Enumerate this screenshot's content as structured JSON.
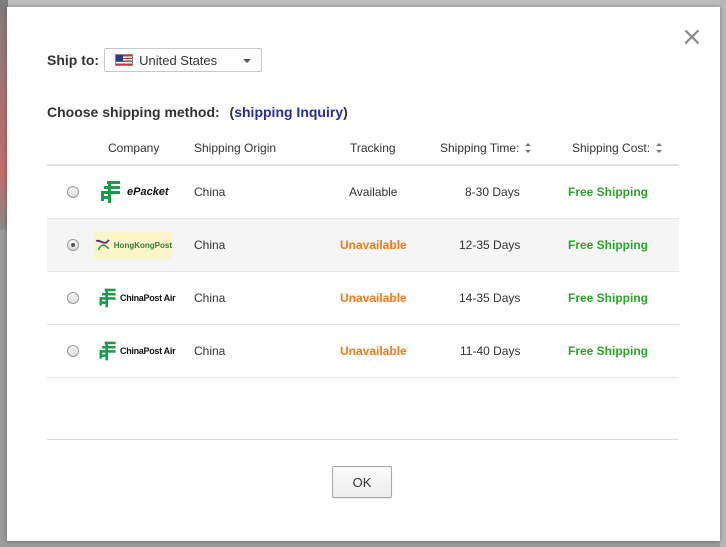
{
  "modal": {
    "ship_to_label": "Ship to:",
    "country": "United States",
    "heading": "Choose shipping method:",
    "inquiry_link": "shipping Inquiry",
    "paren_open": "(",
    "paren_close": ")",
    "ok_label": "OK"
  },
  "table": {
    "headers": {
      "company": "Company",
      "origin": "Shipping Origin",
      "tracking": "Tracking",
      "time": "Shipping Time:",
      "cost": "Shipping Cost:"
    },
    "rows": [
      {
        "company": "ePacket",
        "origin": "China",
        "tracking": "Available",
        "time": "8-30 Days",
        "cost": "Free Shipping",
        "selected": false
      },
      {
        "company": "HongKongPost",
        "origin": "China",
        "tracking": "Unavailable",
        "time": "12-35 Days",
        "cost": "Free Shipping",
        "selected": true
      },
      {
        "company": "ChinaPost Air",
        "origin": "China",
        "tracking": "Unavailable",
        "time": "14-35 Days",
        "cost": "Free Shipping",
        "selected": false
      },
      {
        "company": "ChinaPost Air",
        "origin": "China",
        "tracking": "Unavailable",
        "time": "11-40 Days",
        "cost": "Free Shipping",
        "selected": false
      }
    ]
  },
  "icons": {
    "close": "close-icon",
    "flag": "us-flag-icon",
    "dropdown": "chevron-down-icon",
    "sort": "sort-icon",
    "carrier_logo": "china-post-logo"
  },
  "colors": {
    "unavailable": "#f07a16",
    "free_shipping": "#2aa52a",
    "link": "#2a2aa6",
    "china_post_green": "#1a9d4b"
  }
}
